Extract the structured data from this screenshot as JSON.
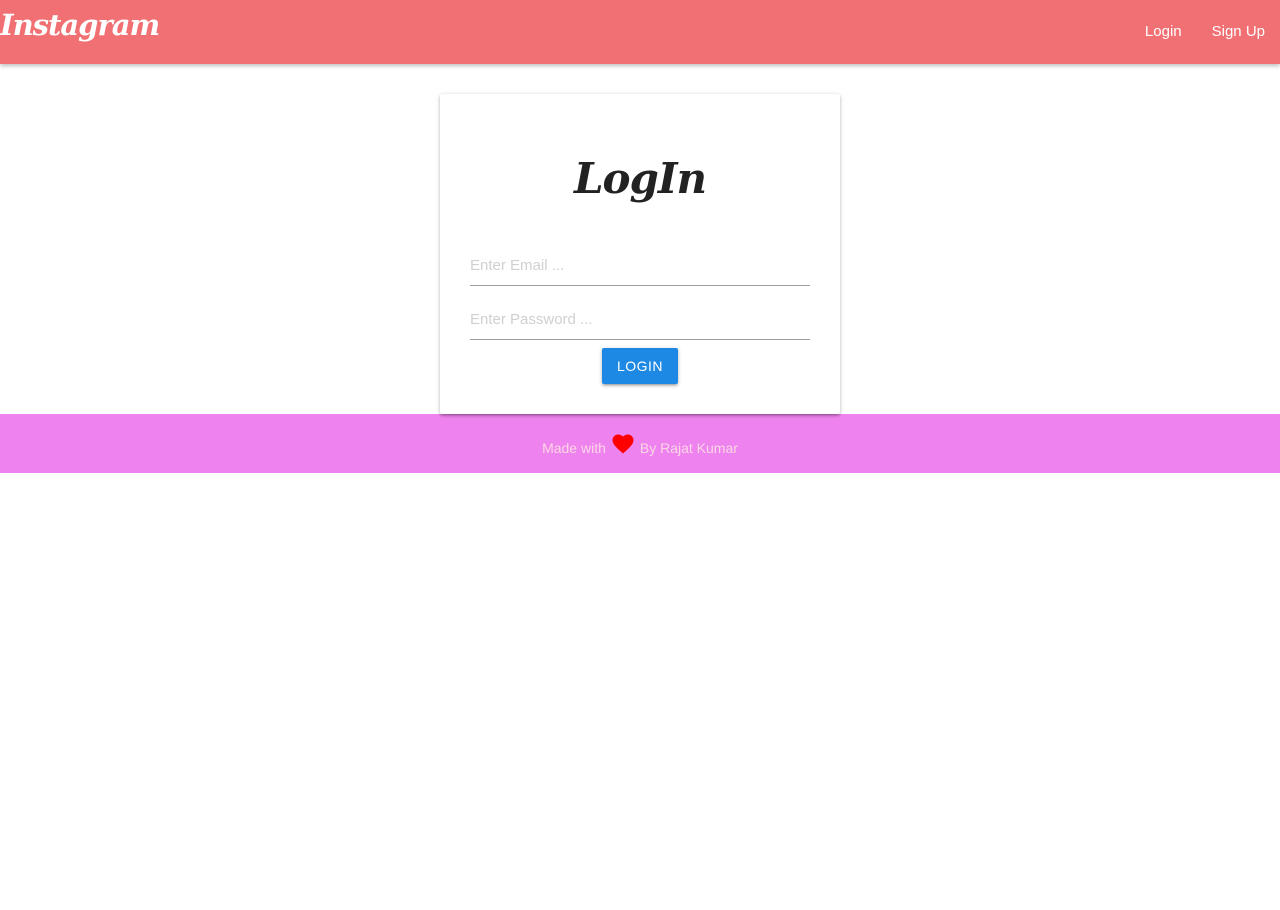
{
  "navbar": {
    "brand": "Instagram",
    "links": [
      {
        "label": "Login"
      },
      {
        "label": "Sign Up"
      }
    ],
    "color": "#f07073"
  },
  "login_card": {
    "title": "LogIn",
    "email_placeholder": "Enter Email ...",
    "password_placeholder": "Enter Password ...",
    "button_label": "Login",
    "button_color": "#1e88e5"
  },
  "footer": {
    "text_before": "Made with",
    "icon": "heart-icon",
    "text_after": "By Rajat Kumar",
    "color": "#ee82ee"
  }
}
